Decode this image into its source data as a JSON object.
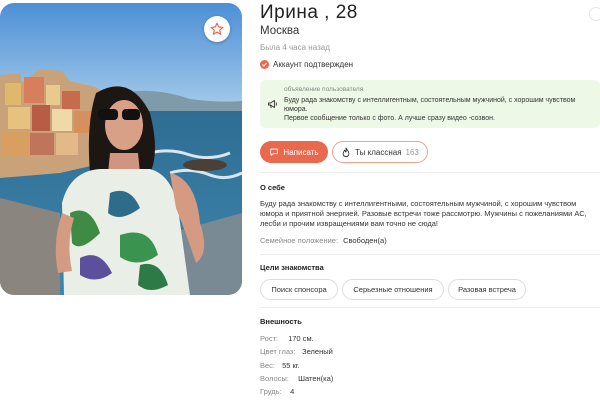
{
  "profile": {
    "name": "Ирина , 28",
    "city": "Москва",
    "last_seen": "Была 4 часа назад",
    "verified": "Аккаунт подтвержден"
  },
  "announcement": {
    "label": "объявление пользователя",
    "text": "Буду рада знакомству с интеллигентным, состоятельным мужчиной, с хорошим чувством юмора.\nПервое сообщение только с фото. А лучше сразу видео -созвон."
  },
  "actions": {
    "write_label": "Написать",
    "like_label": "Ты классная",
    "like_count": "163"
  },
  "about": {
    "title": "О себе",
    "text": "Буду рада знакомству с интеллигентными, состоятельным мужчиной, с хорошим чувством юмора и приятной энергией. Разовые встречи тоже рассмотрю. Мужчины с пожеланиями АС, лесби и прочим извращениями вам точно не сюда!",
    "marital_key": "Семейное положение:",
    "marital_value": "Свободен(а)"
  },
  "goals": {
    "title": "Цели знакомства",
    "items": [
      "Поиск спонсора",
      "Серьезные отношения",
      "Разовая встреча"
    ]
  },
  "appearance": {
    "title": "Внешность",
    "rows": [
      {
        "key": "Рост:",
        "value": "170 см."
      },
      {
        "key": "Цвет глаз:",
        "value": "Зеленый"
      },
      {
        "key": "Вес:",
        "value": "55 кг."
      },
      {
        "key": "Волосы:",
        "value": "Шатен(ка)"
      },
      {
        "key": "Грудь:",
        "value": "4"
      }
    ]
  },
  "colors": {
    "accent": "#e9694f",
    "announce_bg": "#eef8e6"
  },
  "icons": {
    "favorite": "star-icon",
    "verified": "check-icon",
    "announcement": "megaphone-icon",
    "write": "chat-bubble-icon",
    "like": "flame-icon"
  }
}
